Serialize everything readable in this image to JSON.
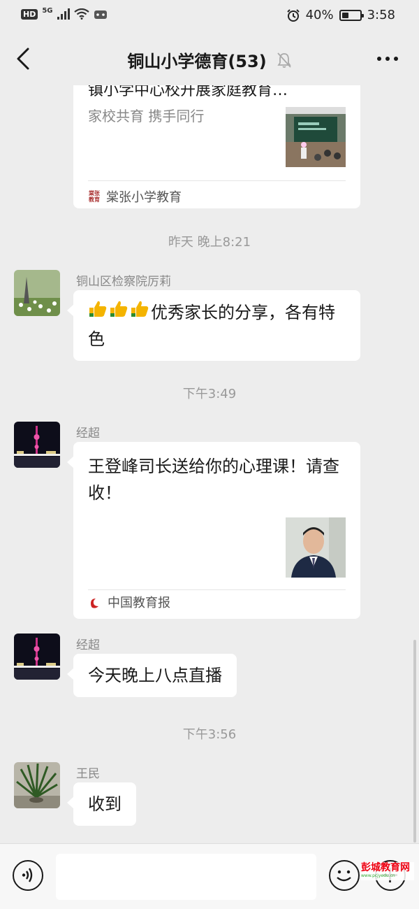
{
  "status_bar": {
    "hd": "HD",
    "network": "5G",
    "battery_text": "40%",
    "battery_level": 0.4,
    "time": "3:58"
  },
  "nav": {
    "title": "铜山小学德育(53)",
    "icons": {
      "back": "chevron-left-icon",
      "mute": "bell-muted-icon",
      "more": "more-dots-icon"
    }
  },
  "messages": {
    "card1": {
      "title_partial": "镇小学中心校开展家庭教育…",
      "desc": "家校共育 携手同行",
      "source": "棠张小学教育",
      "source_logo_text": "棠张教育"
    },
    "time1": "昨天 晚上8:21",
    "msg1": {
      "sender": "铜山区检察院厉莉",
      "text": "优秀家长的分享，各有特色",
      "emoji": "thumbs-up-icon"
    },
    "time2": "下午3:49",
    "msg2": {
      "sender": "经超",
      "title": "王登峰司长送给你的心理课！请查收！",
      "source": "中国教育报"
    },
    "msg3": {
      "sender": "经超",
      "text": "今天晚上八点直播"
    },
    "time3": "下午3:56",
    "msg4": {
      "sender": "王民",
      "text": "收到"
    }
  },
  "input_bar": {
    "icons": {
      "voice": "voice-icon",
      "emoji": "emoji-icon",
      "plus": "plus-icon"
    },
    "input_value": ""
  },
  "watermark": {
    "text": "彭城教育网",
    "sub": "www.pcjyedu.cn"
  },
  "colors": {
    "background": "#ededed",
    "bubble": "#ffffff",
    "secondary_text": "#888888"
  }
}
